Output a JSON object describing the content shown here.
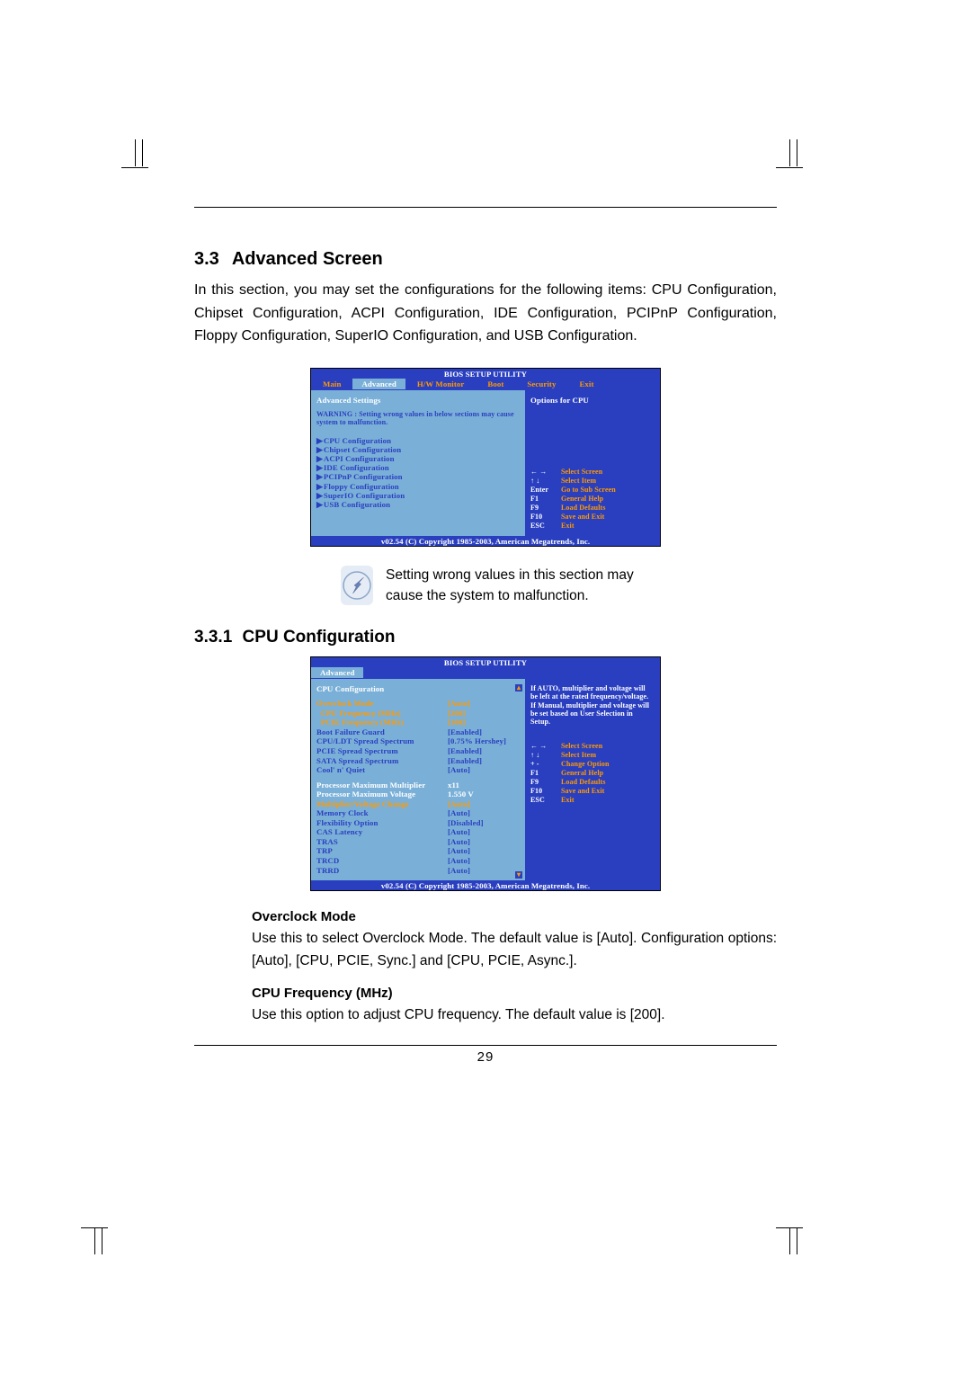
{
  "section": {
    "num": "3.3",
    "title": "Advanced Screen"
  },
  "section_para": "In this section, you may set the configurations for the following items: CPU Configuration, Chipset Configuration, ACPI Configuration, IDE Configuration, PCIPnP Configuration, Floppy Configuration, SuperIO Configuration, and USB Configuration.",
  "bios_title": "BIOS SETUP UTILITY",
  "bios_footer": "v02.54 (C) Copyright 1985-2003, American Megatrends, Inc.",
  "adv": {
    "tabs": [
      "Main",
      "Advanced",
      "H/W Monitor",
      "Boot",
      "Security",
      "Exit"
    ],
    "left_title": "Advanced Settings",
    "warning": "WARNING : Setting wrong values in below sections may cause system to malfunction.",
    "items": [
      "CPU Configuration",
      "Chipset Configuration",
      "ACPI Configuration",
      "IDE Configuration",
      "PCIPnP Configuration",
      "Floppy Configuration",
      "SuperIO Configuration",
      "USB Configuration"
    ],
    "right_title": "Options for CPU",
    "keys": [
      {
        "k": "← →",
        "d": "Select Screen"
      },
      {
        "k": "↑ ↓",
        "d": "Select Item"
      },
      {
        "k": "Enter",
        "d": "Go to Sub Screen"
      },
      {
        "k": "F1",
        "d": "General Help"
      },
      {
        "k": "F9",
        "d": "Load Defaults"
      },
      {
        "k": "F10",
        "d": "Save and Exit"
      },
      {
        "k": "ESC",
        "d": "Exit"
      }
    ]
  },
  "note_text": "Setting wrong values in this section may cause the system to malfunction.",
  "subsection": {
    "num": "3.3.1",
    "title": "CPU Configuration"
  },
  "cpu": {
    "tabs": [
      "Advanced"
    ],
    "left_title": "CPU Configuration",
    "rows": [
      {
        "lbl": "Overclock Mode",
        "val": "[Auto]",
        "cls": "yel"
      },
      {
        "lbl": "  CPU Frequency (MHz)",
        "val": "[200]",
        "cls": "yel"
      },
      {
        "lbl": "  PCIE Frequency (MHz)",
        "val": "[100]",
        "cls": "yel"
      },
      {
        "lbl": "Boot Failure Guard",
        "val": "[Enabled]",
        "cls": ""
      },
      {
        "lbl": "CPU/LDT Spread Spectrum",
        "val": "[0.75% Hershey]",
        "cls": ""
      },
      {
        "lbl": "PCIE Spread Spectrum",
        "val": "[Enabled]",
        "cls": ""
      },
      {
        "lbl": "SATA Spread Spectrum",
        "val": "[Enabled]",
        "cls": ""
      },
      {
        "lbl": "Cool' n' Quiet",
        "val": "[Auto]",
        "cls": ""
      }
    ],
    "mid_rows": [
      {
        "lbl": "Processor Maximum Multiplier",
        "val": "x11",
        "cls": "wh"
      },
      {
        "lbl": "Processor Maximum Voltage",
        "val": "1.550 V",
        "cls": "wh"
      },
      {
        "lbl": "Multiplier/Voltage Change",
        "val": "[Auto]",
        "cls": "yel"
      }
    ],
    "low_rows": [
      {
        "lbl": "Memory Clock",
        "val": "[Auto]",
        "cls": ""
      },
      {
        "lbl": "Flexibility Option",
        "val": "[Disabled]",
        "cls": ""
      },
      {
        "lbl": "CAS Latency",
        "val": "[Auto]",
        "cls": ""
      },
      {
        "lbl": "TRAS",
        "val": "[Auto]",
        "cls": ""
      },
      {
        "lbl": "TRP",
        "val": "[Auto]",
        "cls": ""
      },
      {
        "lbl": "TRCD",
        "val": "[Auto]",
        "cls": ""
      },
      {
        "lbl": "TRRD",
        "val": "[Auto]",
        "cls": ""
      }
    ],
    "help": "If AUTO, multiplier and voltage will be left at the rated frequency/voltage. If Manual, multiplier and voltage will be set based on User Selection in Setup.",
    "keys": [
      {
        "k": "← →",
        "d": "Select Screen"
      },
      {
        "k": "↑ ↓",
        "d": "Select Item"
      },
      {
        "k": "+  -",
        "d": "Change Option"
      },
      {
        "k": "F1",
        "d": "General Help"
      },
      {
        "k": "F9",
        "d": "Load Defaults"
      },
      {
        "k": "F10",
        "d": "Save and Exit"
      },
      {
        "k": "ESC",
        "d": "Exit"
      }
    ]
  },
  "overclock": {
    "h": "Overclock Mode",
    "p": "Use this to select Overclock Mode. The default value is [Auto]. Configuration options: [Auto], [CPU, PCIE, Sync.] and [CPU, PCIE, Async.]."
  },
  "cpufreq": {
    "h": "CPU Frequency (MHz)",
    "p": "Use this option to adjust CPU frequency. The default value is [200]."
  },
  "page_number": "29"
}
